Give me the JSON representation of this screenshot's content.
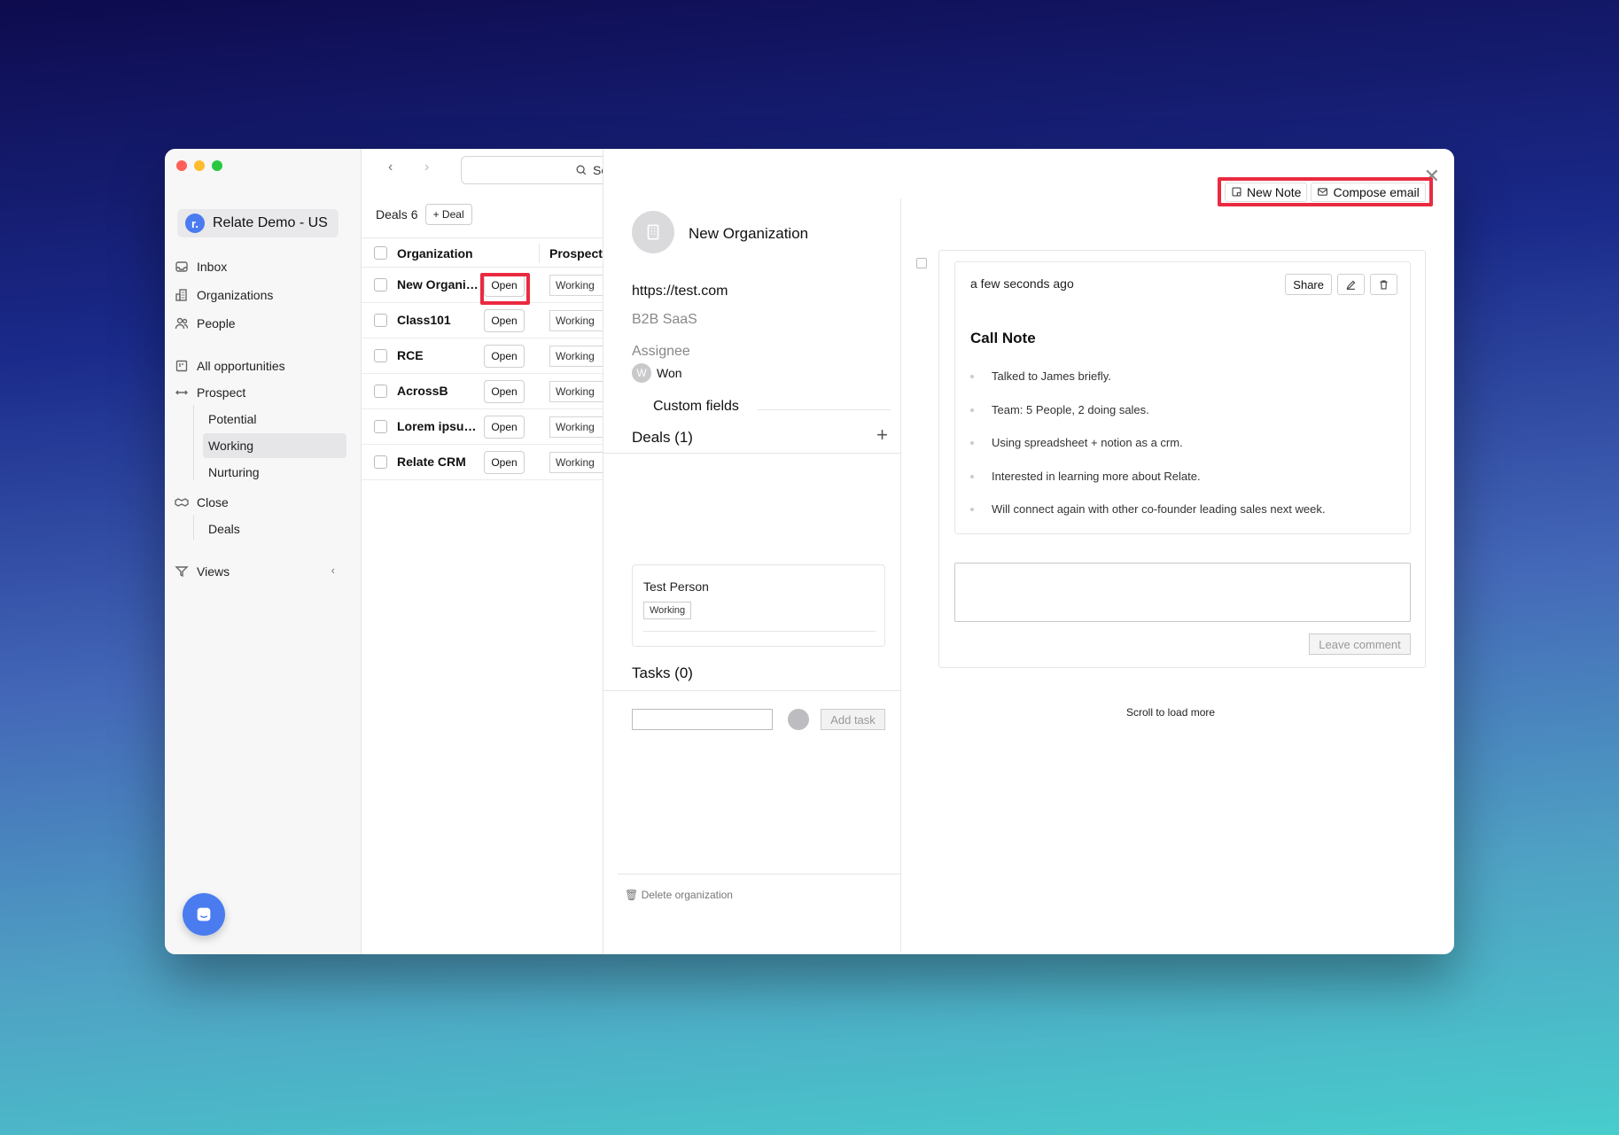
{
  "app": {
    "workspace_initial": "r.",
    "workspace_name": "Relate Demo - US"
  },
  "sidebar": {
    "items": [
      {
        "label": "Inbox",
        "icon": "inbox-icon"
      },
      {
        "label": "Organizations",
        "icon": "building-icon"
      },
      {
        "label": "People",
        "icon": "people-icon"
      },
      {
        "label": "All opportunities",
        "icon": "board-icon"
      },
      {
        "label": "Prospect",
        "icon": "arrows-icon"
      },
      {
        "label": "Close",
        "icon": "handshake-icon"
      },
      {
        "label": "Views",
        "icon": "filter-icon"
      }
    ],
    "prospect_sub": [
      "Potential",
      "Working",
      "Nurturing"
    ],
    "close_sub": [
      "Deals"
    ],
    "active_item": "Working"
  },
  "list": {
    "search_placeholder": "Se",
    "deals_label": "Deals",
    "deals_count": "6",
    "add_deal_label": "+ Deal",
    "columns": [
      "Organization",
      "Prospect"
    ],
    "rows": [
      {
        "name": "New Organiz...",
        "open": "Open",
        "stage": "Working"
      },
      {
        "name": "Class101",
        "open": "Open",
        "stage": "Working"
      },
      {
        "name": "RCE",
        "open": "Open",
        "stage": "Working"
      },
      {
        "name": "AcrossB",
        "open": "Open",
        "stage": "Working"
      },
      {
        "name": "Lorem ipsum ...",
        "open": "Open",
        "stage": "Working"
      },
      {
        "name": "Relate CRM",
        "open": "Open",
        "stage": "Working"
      }
    ]
  },
  "detail": {
    "org_name": "New Organization",
    "url": "https://test.com",
    "category": "B2B SaaS",
    "assignee_label": "Assignee",
    "assignee_initial": "W",
    "assignee_value": "Won",
    "custom_fields_label": "Custom fields",
    "deals_title": "Deals (1)",
    "deal_card": {
      "person": "Test Person",
      "stage": "Working"
    },
    "tasks_title": "Tasks (0)",
    "add_task_label": "Add task",
    "delete_label": "🗑 Delete organization"
  },
  "feed": {
    "new_note_label": "New Note",
    "compose_email_label": "Compose email",
    "note": {
      "time": "a few seconds ago",
      "share_label": "Share",
      "title": "Call Note",
      "bullets": [
        "Talked to James briefly.",
        "Team: 5 People, 2 doing sales.",
        "Using spreadsheet + notion as a crm.",
        "Interested in learning more about Relate.",
        "Will connect again with other co-founder leading sales next week."
      ]
    },
    "leave_comment_label": "Leave comment",
    "scroll_more_label": "Scroll to load more"
  },
  "colors": {
    "accent": "#4a7cf0",
    "highlight": "#ea2a40"
  }
}
